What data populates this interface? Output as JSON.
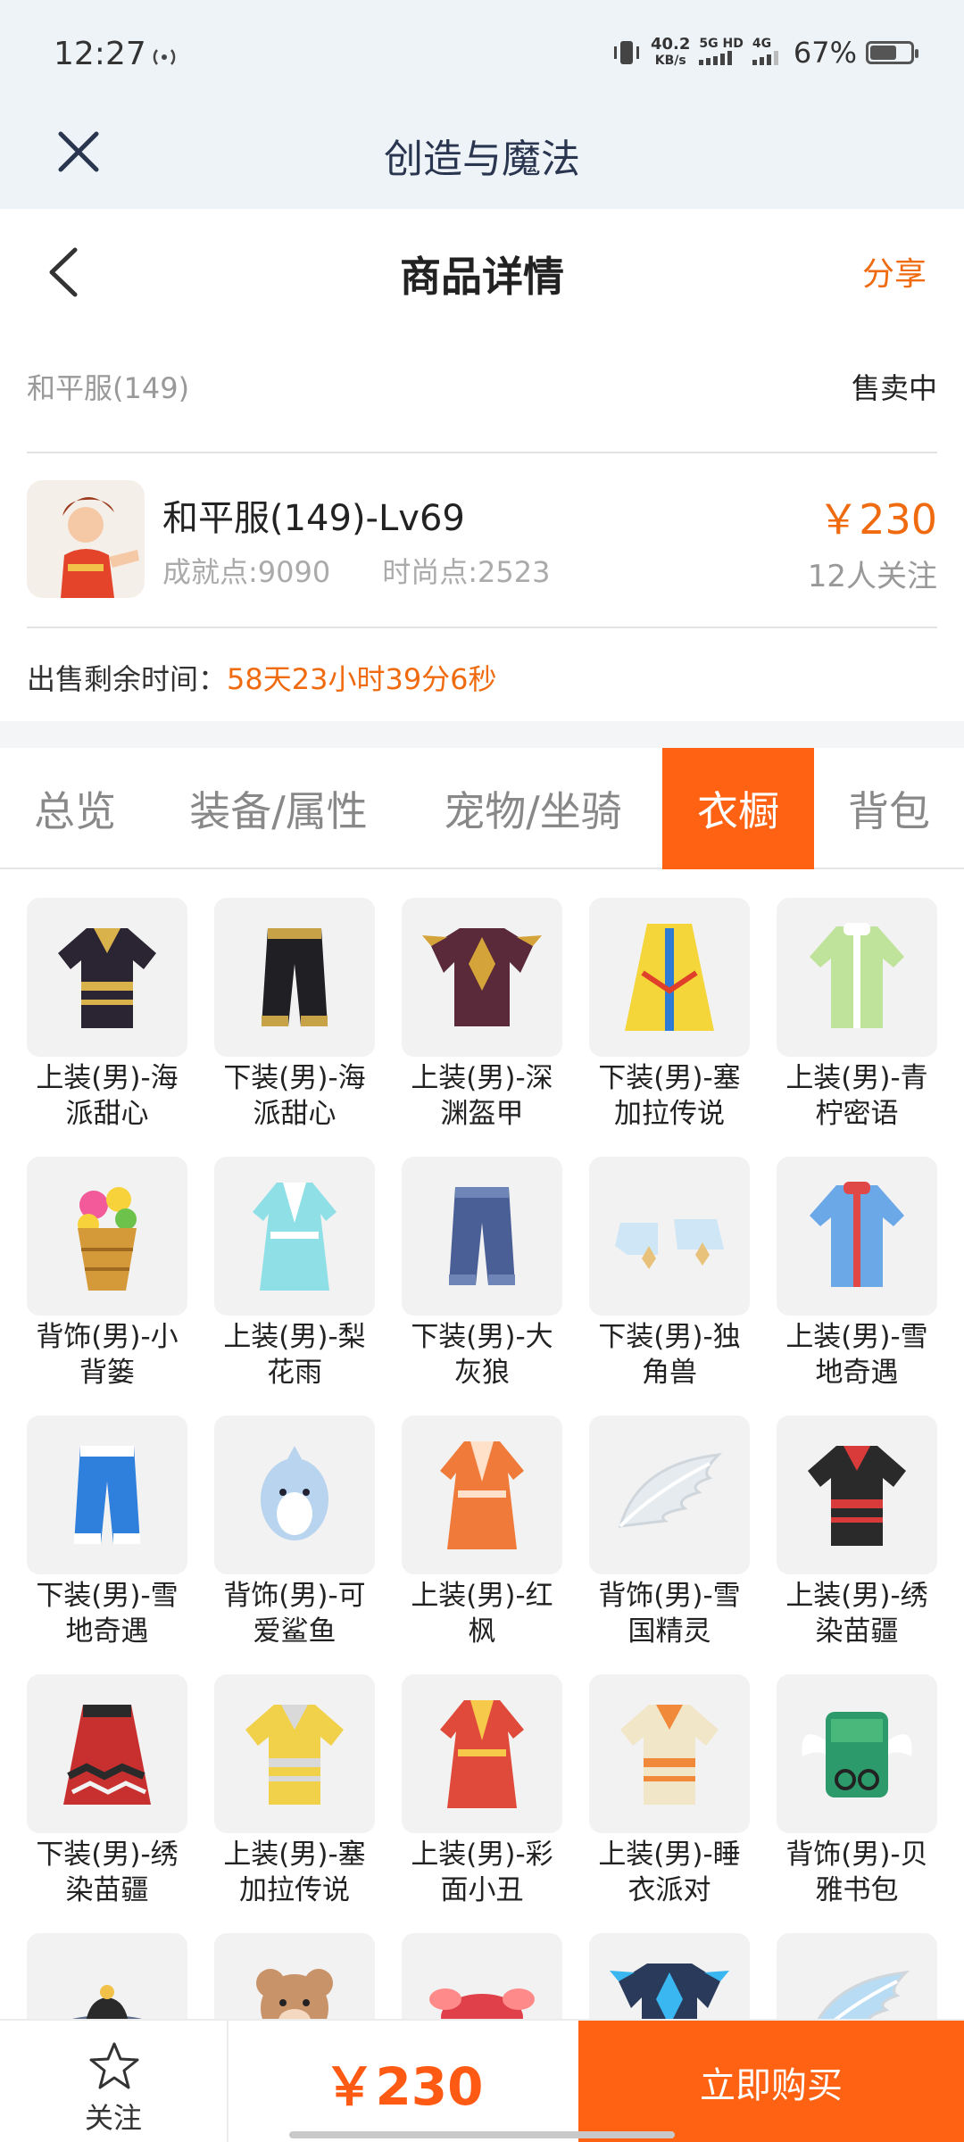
{
  "status_bar": {
    "time": "12:27",
    "speed_value": "40.2",
    "speed_unit": "KB/s",
    "net1": "5G HD",
    "net2": "4G",
    "battery": "67%",
    "battery_level": 0.67
  },
  "app": {
    "title": "创造与魔法"
  },
  "nav": {
    "title": "商品详情",
    "share": "分享"
  },
  "listing": {
    "name": "和平服(149)",
    "status": "售卖中",
    "title": "和平服(149)-Lv69",
    "achievement": "成就点:9090",
    "fashion": "时尚点:2523",
    "price": "￥230",
    "followers": "12人关注",
    "remain_label": "出售剩余时间：",
    "remain_value": "58天23小时39分6秒"
  },
  "tabs": [
    {
      "label": "总览"
    },
    {
      "label": "装备/属性"
    },
    {
      "label": "宠物/坐骑"
    },
    {
      "label": "衣橱"
    },
    {
      "label": "背包"
    }
  ],
  "active_tab": "衣橱",
  "items": [
    {
      "l1": "上装(男)-海",
      "l2": "派甜心",
      "icon": "jacket-icon",
      "c": "#2b2533",
      "c2": "#d9b24c"
    },
    {
      "l1": "下装(男)-海",
      "l2": "派甜心",
      "icon": "pants-icon",
      "c": "#1f1f24",
      "c2": "#c7a247"
    },
    {
      "l1": "上装(男)-深",
      "l2": "渊盔甲",
      "icon": "armor-icon",
      "c": "#5a2a3a",
      "c2": "#d4a43a"
    },
    {
      "l1": "下装(男)-塞",
      "l2": "加拉传说",
      "icon": "cape-icon",
      "c": "#f4d63a",
      "c2": "#2e7bd6"
    },
    {
      "l1": "上装(男)-青",
      "l2": "柠密语",
      "icon": "coat-icon",
      "c": "#bfe39a",
      "c2": "#ffffff"
    },
    {
      "l1": "背饰(男)-小",
      "l2": "背篓",
      "icon": "basket-icon",
      "c": "#d49a3a",
      "c2": "#f25a9a"
    },
    {
      "l1": "上装(男)-梨",
      "l2": "花雨",
      "icon": "robe-icon",
      "c": "#8fe0e6",
      "c2": "#ffffff"
    },
    {
      "l1": "下装(男)-大",
      "l2": "灰狼",
      "icon": "pants-icon",
      "c": "#4a5f96",
      "c2": "#6f85b8"
    },
    {
      "l1": "下装(男)-独",
      "l2": "角兽",
      "icon": "boots-icon",
      "c": "#cfe6f7",
      "c2": "#e8c27a"
    },
    {
      "l1": "上装(男)-雪",
      "l2": "地奇遇",
      "icon": "coat-icon",
      "c": "#6aa8e8",
      "c2": "#e04848"
    },
    {
      "l1": "下装(男)-雪",
      "l2": "地奇遇",
      "icon": "pants-icon",
      "c": "#2f7fdc",
      "c2": "#ffffff"
    },
    {
      "l1": "背饰(男)-可",
      "l2": "爱鲨鱼",
      "icon": "shark-icon",
      "c": "#b8d4ee",
      "c2": "#ffffff"
    },
    {
      "l1": "上装(男)-红",
      "l2": "枫",
      "icon": "robe-icon",
      "c": "#f07a3a",
      "c2": "#ffe0c8"
    },
    {
      "l1": "背饰(男)-雪",
      "l2": "国精灵",
      "icon": "wing-icon",
      "c": "#e6ebef",
      "c2": "#ffffff"
    },
    {
      "l1": "上装(男)-绣",
      "l2": "染苗疆",
      "icon": "jacket-icon",
      "c": "#2a2a2a",
      "c2": "#d93a3a"
    },
    {
      "l1": "下装(男)-绣",
      "l2": "染苗疆",
      "icon": "skirt-icon",
      "c": "#c8302f",
      "c2": "#2a2a2a"
    },
    {
      "l1": "上装(男)-塞",
      "l2": "加拉传说",
      "icon": "jacket-icon",
      "c": "#f2d14a",
      "c2": "#d9d9d9"
    },
    {
      "l1": "上装(男)-彩",
      "l2": "面小丑",
      "icon": "robe-icon",
      "c": "#e04a3a",
      "c2": "#f7c94a"
    },
    {
      "l1": "上装(男)-睡",
      "l2": "衣派对",
      "icon": "jacket-icon",
      "c": "#f2e6c8",
      "c2": "#f08a3a"
    },
    {
      "l1": "背饰(男)-贝",
      "l2": "雅书包",
      "icon": "bag-icon",
      "c": "#2c9a6a",
      "c2": "#ffffff"
    },
    {
      "l1": "",
      "l2": "",
      "icon": "hat-icon",
      "c": "#5b6c8a",
      "c2": "#2a2a2a"
    },
    {
      "l1": "",
      "l2": "",
      "icon": "bear-icon",
      "c": "#c9936a",
      "c2": "#f4d8c0"
    },
    {
      "l1": "",
      "l2": "",
      "icon": "lobster-icon",
      "c": "#e0404a",
      "c2": "#ff8a8a"
    },
    {
      "l1": "",
      "l2": "",
      "icon": "armor-icon",
      "c": "#2a3a5a",
      "c2": "#3ab6f0"
    },
    {
      "l1": "",
      "l2": "",
      "icon": "wing-icon",
      "c": "#b8dcf4",
      "c2": "#ffffff"
    }
  ],
  "bottom": {
    "follow": "关注",
    "price": "￥230",
    "buy": "立即购买"
  },
  "colors": {
    "accent": "#ff6213",
    "price": "#f06b10",
    "header_bg": "#eef3f8"
  }
}
